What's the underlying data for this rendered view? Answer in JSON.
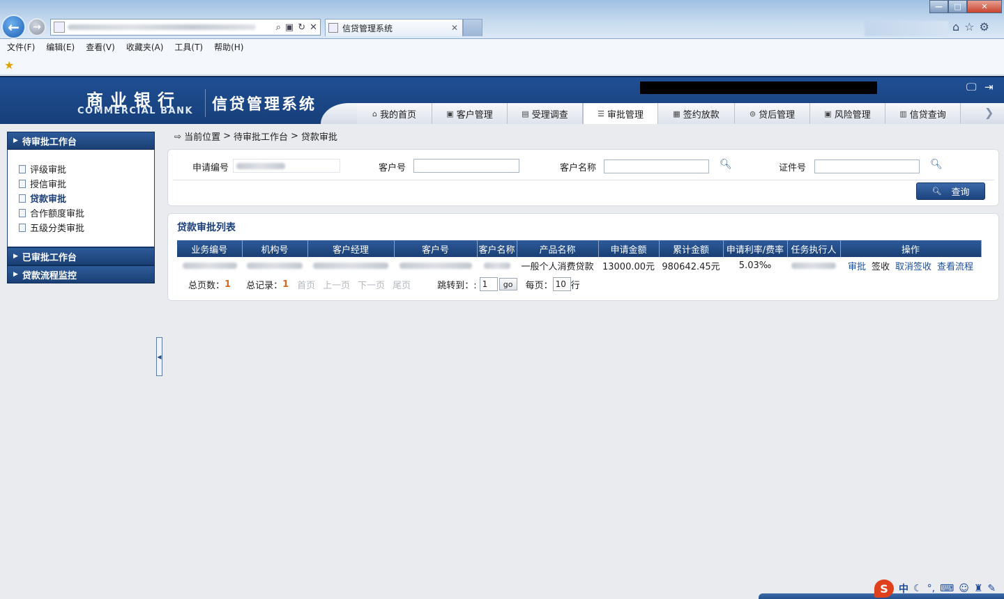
{
  "browser": {
    "tab_title": "信贷管理系统",
    "window_controls": {
      "minimize": "—",
      "maximize": "□",
      "close": "✕"
    },
    "menu": [
      "文件(F)",
      "编辑(E)",
      "查看(V)",
      "收藏夹(A)",
      "工具(T)",
      "帮助(H)"
    ]
  },
  "header": {
    "logo_cn": "商业银行",
    "logo_en": "COMMERCIAL BANK",
    "system_title": "信贷管理系统",
    "nav_tabs": [
      {
        "label": "我的首页",
        "icon": "home-icon"
      },
      {
        "label": "客户管理",
        "icon": "customer-icon"
      },
      {
        "label": "受理调查",
        "icon": "survey-icon"
      },
      {
        "label": "审批管理",
        "icon": "approval-icon",
        "active": true
      },
      {
        "label": "签约放款",
        "icon": "contract-icon"
      },
      {
        "label": "贷后管理",
        "icon": "post-loan-icon"
      },
      {
        "label": "风险管理",
        "icon": "risk-icon"
      },
      {
        "label": "信贷查询",
        "icon": "query-icon"
      }
    ]
  },
  "sidebar": {
    "pending_title": "待审批工作台",
    "items": [
      "评级审批",
      "授信审批",
      "贷款审批",
      "合作额度审批",
      "五级分类审批"
    ],
    "active_index": 2,
    "approved_title": "已审批工作台",
    "monitor_title": "贷款流程监控"
  },
  "breadcrumb": {
    "prefix": "当前位置",
    "sep": ">",
    "level1": "待审批工作台",
    "level2": "贷款审批"
  },
  "search": {
    "app_no_label": "申请编号",
    "customer_no_label": "客户号",
    "customer_name_label": "客户名称",
    "id_no_label": "证件号",
    "query_button": "查询"
  },
  "list": {
    "title": "贷款审批列表",
    "columns": [
      "业务编号",
      "机构号",
      "客户经理",
      "客户号",
      "客户名称",
      "产品名称",
      "申请金额",
      "累计金额",
      "申请利率/费率",
      "任务执行人",
      "操作"
    ],
    "row": {
      "product": "一般个人消费贷款",
      "apply_amount": "13000.00元",
      "total_amount": "980642.45元",
      "rate": "5.03‰",
      "actions": [
        "审批",
        "签收",
        "取消签收",
        "查看流程"
      ]
    }
  },
  "pager": {
    "total_pages_label": "总页数：",
    "total_pages": "1",
    "total_records_label": "总记录：",
    "total_records": "1",
    "first": "首页",
    "prev": "上一页",
    "next": "下一页",
    "last": "尾页",
    "jump_label": "跳转到：:",
    "jump_value": "1",
    "go": "go",
    "per_page_label": "每页：",
    "per_page_value": "10",
    "per_page_unit": "行"
  },
  "ime": {
    "logo": "S",
    "mode": "中"
  }
}
